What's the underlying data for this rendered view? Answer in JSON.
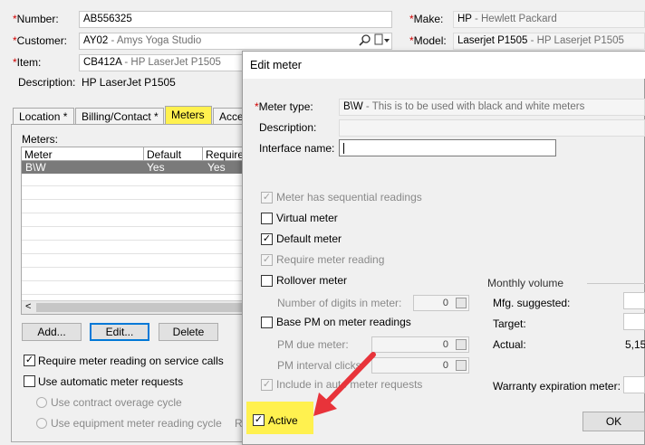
{
  "main": {
    "number_label": "Number:",
    "number_value": "AB556325",
    "customer_label": "Customer:",
    "customer_code": "AY02",
    "customer_name": " - Amys Yoga Studio",
    "item_label": "Item:",
    "item_code": "CB412A",
    "item_name": " - HP LaserJet P1505",
    "description_label": "Description:",
    "description_value": "HP LaserJet P1505",
    "make_label": "Make:",
    "make_code": "HP",
    "make_name": " - Hewlett Packard",
    "model_label": "Model:",
    "model_code": "Laserjet P1505",
    "model_name": " - HP Laserjet P1505"
  },
  "tabs": [
    {
      "label": "Location *"
    },
    {
      "label": "Billing/Contact *"
    },
    {
      "label": "Meters"
    },
    {
      "label": "Acce"
    }
  ],
  "meters": {
    "label": "Meters:",
    "columns": [
      "Meter",
      "Default",
      "Required"
    ],
    "row": {
      "meter": "B\\W",
      "default": "Yes",
      "required": "Yes"
    },
    "scroll_left_glyph": "<",
    "add_label": "Add...",
    "edit_label": "Edit...",
    "delete_label": "Delete",
    "require_reading_label": "Require meter reading on service calls",
    "auto_requests_label": "Use automatic meter requests",
    "contract_overage_label": "Use contract overage cycle",
    "equipment_cycle_label": "Use equipment meter reading cycle",
    "cut_letter": "R"
  },
  "dialog": {
    "title": "Edit meter",
    "meter_type_label": "Meter type:",
    "meter_type_code": "B\\W",
    "meter_type_desc": " - This is to be used with black and white meters",
    "description_label": "Description:",
    "interface_label": "Interface name:",
    "sequential_label": "Meter has sequential readings",
    "virtual_label": "Virtual meter",
    "default_label": "Default meter",
    "require_label": "Require meter reading",
    "rollover_label": "Rollover meter",
    "digits_label": "Number of digits in meter:",
    "digits_value": "0",
    "base_pm_label": "Base PM on meter readings",
    "pm_due_label": "PM due meter:",
    "pm_due_value": "0",
    "pm_interval_label": "PM interval clicks:",
    "pm_interval_value": "0",
    "include_auto_label": "Include in auto meter requests",
    "active_label": "Active",
    "monthly_volume_label": "Monthly volume",
    "mfg_label": "Mfg. suggested:",
    "target_label": "Target:",
    "actual_label": "Actual:",
    "actual_value": "5,15",
    "warranty_label": "Warranty expiration meter:",
    "ok_label": "OK",
    "check_glyph": "✓"
  },
  "colors": {
    "highlight": "#fff14f",
    "arrow": "#e8333a",
    "required_star": "#d00000",
    "selected_row": "#7a7a7a"
  }
}
